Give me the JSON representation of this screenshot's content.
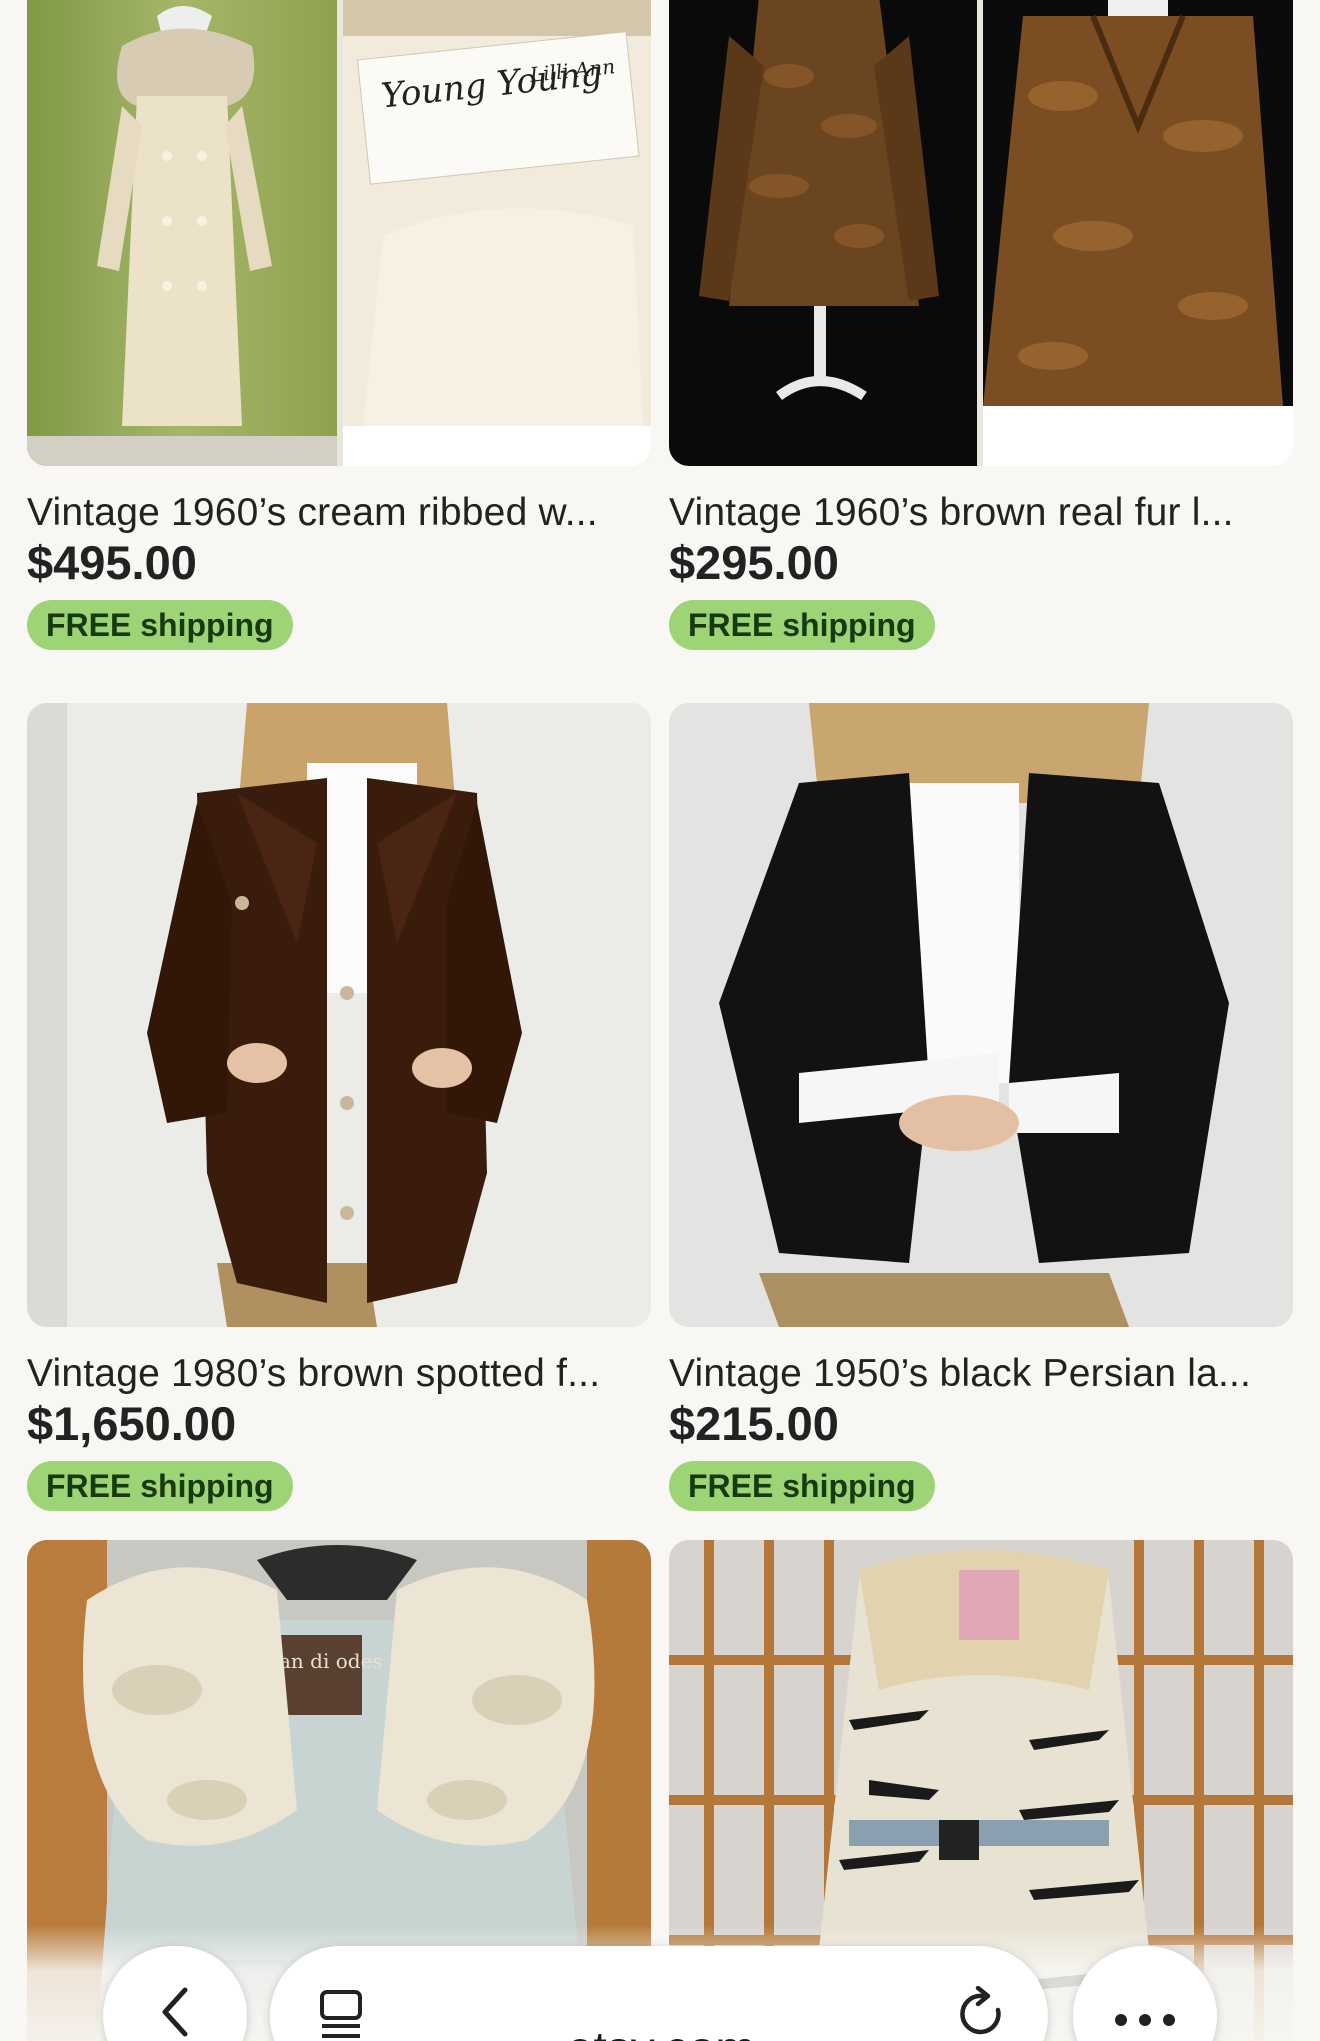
{
  "listings": [
    {
      "title": "Vintage 1960’s cream ribbed w...",
      "price": "$495.00",
      "shipping": "FREE shipping"
    },
    {
      "title": "Vintage 1960’s brown real fur l...",
      "price": "$295.00",
      "shipping": "FREE shipping"
    },
    {
      "title": "Vintage 1980’s brown spotted f...",
      "price": "$1,650.00",
      "shipping": "FREE shipping"
    },
    {
      "title": "Vintage 1950’s black Persian la...",
      "price": "$215.00",
      "shipping": "FREE shipping"
    }
  ],
  "label_text": {
    "young_young": "Young Young",
    "lilli_ann": "Lilli Ann",
    "brand_tag": "an di odes"
  },
  "browser": {
    "url": "etsy.com",
    "back_icon": "chevron-left-icon",
    "tabs_icon": "tabs-icon",
    "reload_icon": "reload-icon",
    "more_icon": "more-icon"
  },
  "colors": {
    "badge_bg": "#9dd475",
    "badge_text": "#173a12",
    "page_bg": "#f8f7f4"
  }
}
